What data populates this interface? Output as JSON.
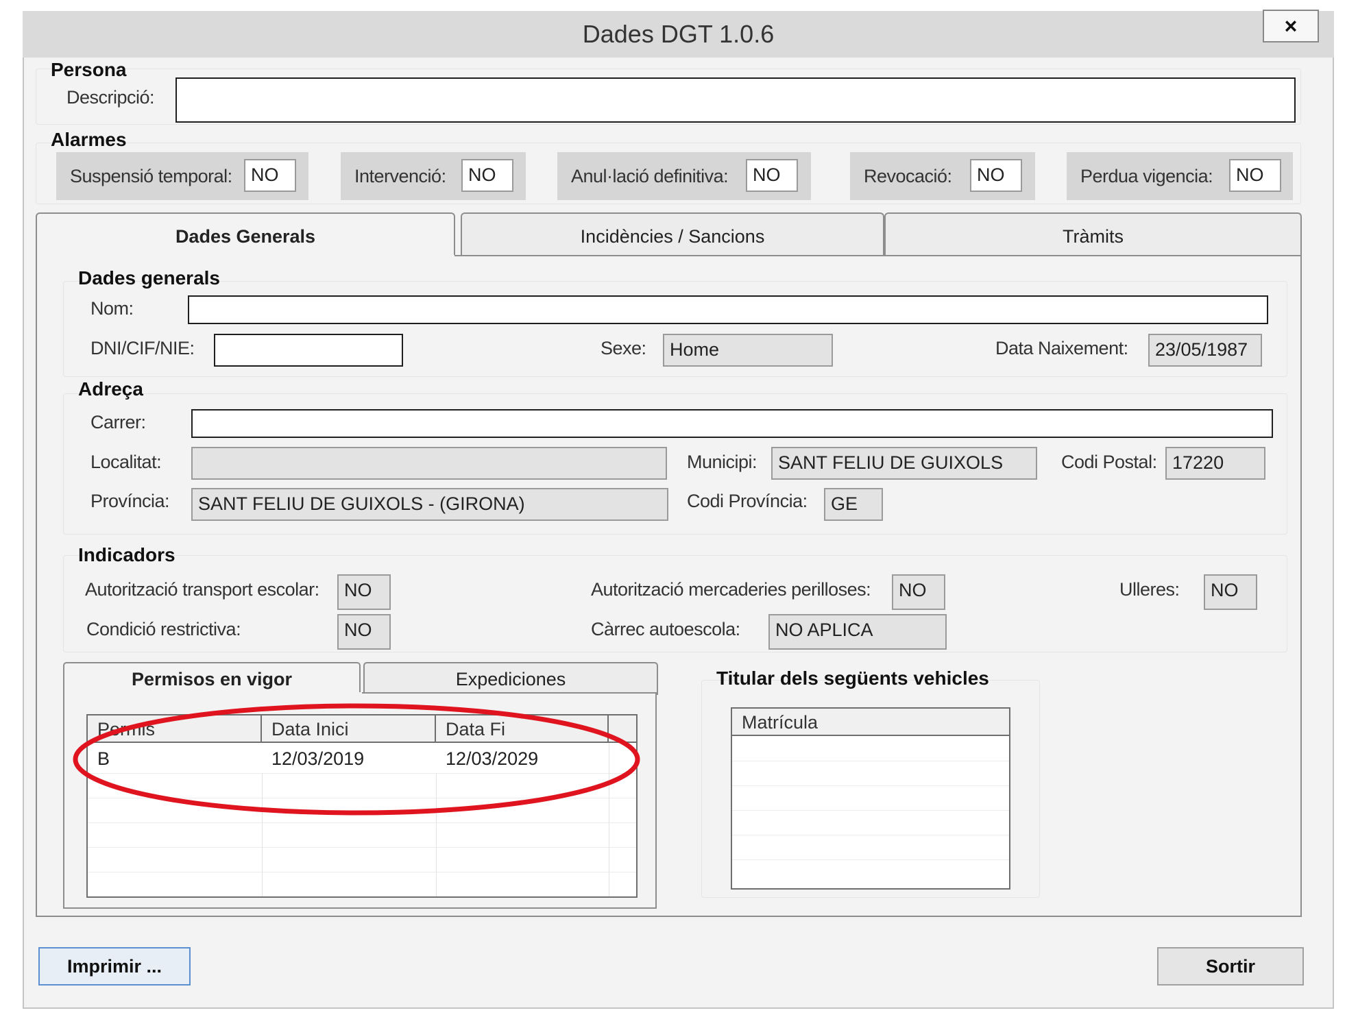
{
  "window": {
    "title": "Dades DGT 1.0.6",
    "close_label": "×"
  },
  "persona": {
    "group_title": "Persona",
    "descripcio_label": "Descripció:",
    "descripcio_value": ""
  },
  "alarmes": {
    "group_title": "Alarmes",
    "items": [
      {
        "label": "Suspensió temporal:",
        "value": "NO"
      },
      {
        "label": "Intervenció:",
        "value": "NO"
      },
      {
        "label": "Anul·lació definitiva:",
        "value": "NO"
      },
      {
        "label": "Revocació:",
        "value": "NO"
      },
      {
        "label": "Perdua vigencia:",
        "value": "NO"
      }
    ]
  },
  "tabs": [
    {
      "label": "Dades Generals",
      "active": true
    },
    {
      "label": "Incidències / Sancions",
      "active": false
    },
    {
      "label": "Tràmits",
      "active": false
    }
  ],
  "dades_generals": {
    "group_title": "Dades generals",
    "nom_label": "Nom:",
    "nom_value": "",
    "dni_label": "DNI/CIF/NIE:",
    "dni_value": "",
    "sexe_label": "Sexe:",
    "sexe_value": "Home",
    "naixement_label": "Data Naixement:",
    "naixement_value": "23/05/1987"
  },
  "adreca": {
    "group_title": "Adreça",
    "carrer_label": "Carrer:",
    "carrer_value": "",
    "localitat_label": "Localitat:",
    "localitat_value": "",
    "municipi_label": "Municipi:",
    "municipi_value": "SANT FELIU DE GUIXOLS",
    "codi_postal_label": "Codi Postal:",
    "codi_postal_value": "17220",
    "provincia_label": "Província:",
    "provincia_value": "SANT FELIU DE GUIXOLS - (GIRONA)",
    "codi_provincia_label": "Codi Província:",
    "codi_provincia_value": "GE"
  },
  "indicadors": {
    "group_title": "Indicadors",
    "transport_escolar_label": "Autorització transport escolar:",
    "transport_escolar_value": "NO",
    "mercaderies_label": "Autorització mercaderies perilloses:",
    "mercaderies_value": "NO",
    "ulleres_label": "Ulleres:",
    "ulleres_value": "NO",
    "condicio_label": "Condició restrictiva:",
    "condicio_value": "NO",
    "carrec_label": "Càrrec autoescola:",
    "carrec_value": "NO APLICA"
  },
  "permisos": {
    "tabs": [
      {
        "label": "Permisos en vigor",
        "active": true
      },
      {
        "label": "Expediciones",
        "active": false
      }
    ],
    "columns": [
      "Permis",
      "Data Inici",
      "Data Fi"
    ],
    "rows": [
      [
        "B",
        "12/03/2019",
        "12/03/2029"
      ]
    ],
    "highlight_color": "#e0141e"
  },
  "vehicles": {
    "group_title": "Titular dels següents vehicles",
    "columns": [
      "Matrícula"
    ],
    "rows": []
  },
  "buttons": {
    "imprimir_label": "Imprimir ...",
    "sortir_label": "Sortir"
  }
}
